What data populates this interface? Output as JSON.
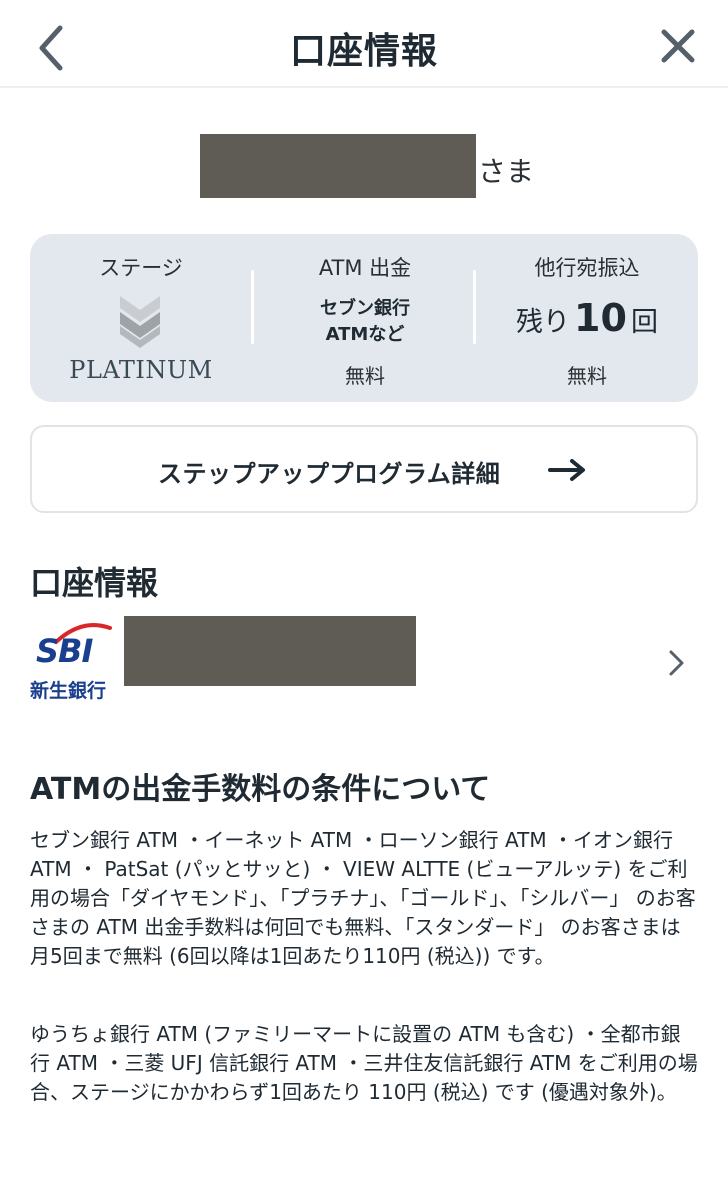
{
  "header": {
    "title": "口座情報",
    "back_icon": "chevron-left-icon",
    "close_icon": "close-icon"
  },
  "customer": {
    "name_suffix": "さま"
  },
  "status_card": {
    "stage": {
      "label": "ステージ",
      "value": "PLATINUM",
      "icon": "stage-chevron-icon"
    },
    "atm": {
      "label": "ATM 出金",
      "line1": "セブン銀行",
      "line2": "ATMなど",
      "foot": "無料"
    },
    "transfer": {
      "label": "他行宛振込",
      "prefix": "残り",
      "count": "10",
      "suffix": "回",
      "foot": "無料"
    }
  },
  "step_program": {
    "label": "ステップアッププログラム詳細",
    "icon": "arrow-right-icon"
  },
  "account_section": {
    "title": "口座情報",
    "bank_logo_text": "SBI",
    "bank_name": "新生銀行",
    "chevron_icon": "chevron-right-icon"
  },
  "fee_section": {
    "title": "ATMの出金手数料の条件について",
    "paragraph1": "セブン銀行 ATM ・イーネット ATM ・ローソン銀行 ATM ・イオン銀行 ATM ・ PatSat (パッとサッと) ・ VIEW ALTTE (ビューアルッテ) をご利用の場合「ダイヤモンド」、「プラチナ」、「ゴールド」、「シルバー」 のお客さまの ATM 出金手数料は何回でも無料、「スタンダード」 のお客さまは月5回まで無料 (6回以降は1回あたり110円 (税込)) です。",
    "paragraph2": "ゆうちょ銀行 ATM (ファミリーマートに設置の ATM も含む) ・全都市銀行 ATM ・三菱 UFJ 信託銀行 ATM ・三井住友信託銀行 ATM をご利用の場合、ステージにかかわらず1回あたり 110円 (税込) です (優遇対象外)。"
  },
  "colors": {
    "card_bg": "#e3e8ee",
    "text": "#1f2a33",
    "brand_blue": "#1b3f8f",
    "brand_red": "#d8262b",
    "redaction": "#5f5c56"
  }
}
